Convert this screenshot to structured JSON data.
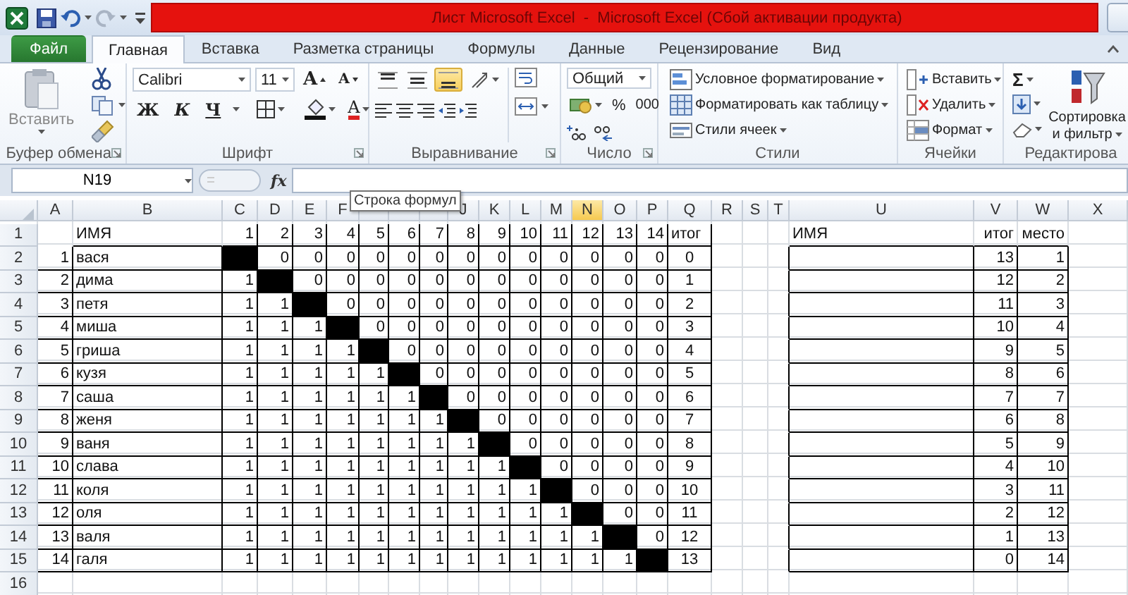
{
  "title_bar": {
    "title": "Лист Microsoft Excel  -  Microsoft Excel (Сбой активации продукта)"
  },
  "tabs": [
    {
      "label": "Файл",
      "kind": "file",
      "selected": false
    },
    {
      "label": "Главная",
      "kind": "tab",
      "selected": true
    },
    {
      "label": "Вставка",
      "kind": "tab",
      "selected": false
    },
    {
      "label": "Разметка страницы",
      "kind": "tab",
      "selected": false
    },
    {
      "label": "Формулы",
      "kind": "tab",
      "selected": false
    },
    {
      "label": "Данные",
      "kind": "tab",
      "selected": false
    },
    {
      "label": "Рецензирование",
      "kind": "tab",
      "selected": false
    },
    {
      "label": "Вид",
      "kind": "tab",
      "selected": false
    }
  ],
  "ribbon": {
    "groups": [
      {
        "kind": "clipboard",
        "label": "Буфер обмена",
        "paste_label": "Вставить"
      },
      {
        "kind": "font",
        "label": "Шрифт",
        "font_name": "Calibri",
        "font_size": "11",
        "grow": "A",
        "shrink": "A",
        "bold": "Ж",
        "italic": "К",
        "underline": "Ч",
        "font_color": "A"
      },
      {
        "kind": "alignment",
        "label": "Выравнивание",
        "vertical_buttons": [
          {
            "selected": false
          },
          {
            "selected": false
          },
          {
            "selected": true
          }
        ]
      },
      {
        "kind": "number",
        "label": "Число",
        "format": "Общий",
        "percent": "%",
        "thousands": "000"
      },
      {
        "kind": "styles",
        "label": "Стили",
        "buttons": [
          "Условное форматирование",
          "Форматировать как таблицу",
          "Стили ячеек"
        ]
      },
      {
        "kind": "cells",
        "label": "Ячейки",
        "buttons": [
          "Вставить",
          "Удалить",
          "Формат"
        ]
      },
      {
        "kind": "editing",
        "label": "Редактирова",
        "sigma": "Σ",
        "sort_label": "Сортировка и фильтр"
      }
    ]
  },
  "formula_bar": {
    "name_box": "N19",
    "function_label": "fx",
    "tooltip": "Строка формул"
  },
  "sheet": {
    "column_headers": [
      {
        "label": "A",
        "selected": false
      },
      {
        "label": "B",
        "selected": false
      },
      {
        "label": "C",
        "selected": false
      },
      {
        "label": "D",
        "selected": false
      },
      {
        "label": "E",
        "selected": false
      },
      {
        "label": "F",
        "selected": false
      },
      {
        "selected": false
      },
      {
        "selected": false
      },
      {
        "selected": false
      },
      {
        "label": "J",
        "selected": false
      },
      {
        "label": "K",
        "selected": false
      },
      {
        "label": "L",
        "selected": false
      },
      {
        "label": "M",
        "selected": false
      },
      {
        "label": "N",
        "selected": true
      },
      {
        "label": "O",
        "selected": false
      },
      {
        "label": "P",
        "selected": false
      },
      {
        "label": "Q",
        "selected": false
      },
      {
        "label": "R",
        "selected": false
      },
      {
        "label": "S",
        "selected": false
      },
      {
        "label": "T",
        "selected": false
      },
      {
        "label": "U",
        "selected": false
      },
      {
        "label": "V",
        "selected": false
      },
      {
        "label": "W",
        "selected": false
      },
      {
        "label": "X",
        "selected": false
      }
    ],
    "header_row": {
      "number": "1",
      "name": "ИМЯ",
      "scores": [
        "1",
        "2",
        "3",
        "4",
        "5",
        "6",
        "7",
        "8",
        "9",
        "10",
        "11",
        "12",
        "13",
        "14"
      ],
      "total": "итог",
      "rank_name": "ИМЯ",
      "rank_total": "итог",
      "rank_place": "место"
    },
    "rows": [
      {
        "number": "2",
        "index": "1",
        "name": "вася",
        "scores": [
          {
            "blocked": true
          },
          {
            "value": "0",
            "blocked": false
          },
          {
            "value": "0",
            "blocked": false
          },
          {
            "value": "0",
            "blocked": false
          },
          {
            "value": "0",
            "blocked": false
          },
          {
            "value": "0",
            "blocked": false
          },
          {
            "value": "0",
            "blocked": false
          },
          {
            "value": "0",
            "blocked": false
          },
          {
            "value": "0",
            "blocked": false
          },
          {
            "value": "0",
            "blocked": false
          },
          {
            "value": "0",
            "blocked": false
          },
          {
            "value": "0",
            "blocked": false
          },
          {
            "value": "0",
            "blocked": false
          },
          {
            "value": "0",
            "blocked": false
          }
        ],
        "total": "0",
        "rank_total": "13",
        "rank_place": "1"
      },
      {
        "number": "3",
        "index": "2",
        "name": "дима",
        "scores": [
          {
            "value": "1",
            "blocked": false
          },
          {
            "blocked": true
          },
          {
            "value": "0",
            "blocked": false
          },
          {
            "value": "0",
            "blocked": false
          },
          {
            "value": "0",
            "blocked": false
          },
          {
            "value": "0",
            "blocked": false
          },
          {
            "value": "0",
            "blocked": false
          },
          {
            "value": "0",
            "blocked": false
          },
          {
            "value": "0",
            "blocked": false
          },
          {
            "value": "0",
            "blocked": false
          },
          {
            "value": "0",
            "blocked": false
          },
          {
            "value": "0",
            "blocked": false
          },
          {
            "value": "0",
            "blocked": false
          },
          {
            "value": "0",
            "blocked": false
          }
        ],
        "total": "1",
        "rank_total": "12",
        "rank_place": "2"
      },
      {
        "number": "4",
        "index": "3",
        "name": "петя",
        "scores": [
          {
            "value": "1",
            "blocked": false
          },
          {
            "value": "1",
            "blocked": false
          },
          {
            "blocked": true
          },
          {
            "value": "0",
            "blocked": false
          },
          {
            "value": "0",
            "blocked": false
          },
          {
            "value": "0",
            "blocked": false
          },
          {
            "value": "0",
            "blocked": false
          },
          {
            "value": "0",
            "blocked": false
          },
          {
            "value": "0",
            "blocked": false
          },
          {
            "value": "0",
            "blocked": false
          },
          {
            "value": "0",
            "blocked": false
          },
          {
            "value": "0",
            "blocked": false
          },
          {
            "value": "0",
            "blocked": false
          },
          {
            "value": "0",
            "blocked": false
          }
        ],
        "total": "2",
        "rank_total": "11",
        "rank_place": "3"
      },
      {
        "number": "5",
        "index": "4",
        "name": "миша",
        "scores": [
          {
            "value": "1",
            "blocked": false
          },
          {
            "value": "1",
            "blocked": false
          },
          {
            "value": "1",
            "blocked": false
          },
          {
            "blocked": true
          },
          {
            "value": "0",
            "blocked": false
          },
          {
            "value": "0",
            "blocked": false
          },
          {
            "value": "0",
            "blocked": false
          },
          {
            "value": "0",
            "blocked": false
          },
          {
            "value": "0",
            "blocked": false
          },
          {
            "value": "0",
            "blocked": false
          },
          {
            "value": "0",
            "blocked": false
          },
          {
            "value": "0",
            "blocked": false
          },
          {
            "value": "0",
            "blocked": false
          },
          {
            "value": "0",
            "blocked": false
          }
        ],
        "total": "3",
        "rank_total": "10",
        "rank_place": "4"
      },
      {
        "number": "6",
        "index": "5",
        "name": "гриша",
        "scores": [
          {
            "value": "1",
            "blocked": false
          },
          {
            "value": "1",
            "blocked": false
          },
          {
            "value": "1",
            "blocked": false
          },
          {
            "value": "1",
            "blocked": false
          },
          {
            "blocked": true
          },
          {
            "value": "0",
            "blocked": false
          },
          {
            "value": "0",
            "blocked": false
          },
          {
            "value": "0",
            "blocked": false
          },
          {
            "value": "0",
            "blocked": false
          },
          {
            "value": "0",
            "blocked": false
          },
          {
            "value": "0",
            "blocked": false
          },
          {
            "value": "0",
            "blocked": false
          },
          {
            "value": "0",
            "blocked": false
          },
          {
            "value": "0",
            "blocked": false
          }
        ],
        "total": "4",
        "rank_total": "9",
        "rank_place": "5"
      },
      {
        "number": "7",
        "index": "6",
        "name": "кузя",
        "scores": [
          {
            "value": "1",
            "blocked": false
          },
          {
            "value": "1",
            "blocked": false
          },
          {
            "value": "1",
            "blocked": false
          },
          {
            "value": "1",
            "blocked": false
          },
          {
            "value": "1",
            "blocked": false
          },
          {
            "blocked": true
          },
          {
            "value": "0",
            "blocked": false
          },
          {
            "value": "0",
            "blocked": false
          },
          {
            "value": "0",
            "blocked": false
          },
          {
            "value": "0",
            "blocked": false
          },
          {
            "value": "0",
            "blocked": false
          },
          {
            "value": "0",
            "blocked": false
          },
          {
            "value": "0",
            "blocked": false
          },
          {
            "value": "0",
            "blocked": false
          }
        ],
        "total": "5",
        "rank_total": "8",
        "rank_place": "6"
      },
      {
        "number": "8",
        "index": "7",
        "name": "саша",
        "scores": [
          {
            "value": "1",
            "blocked": false
          },
          {
            "value": "1",
            "blocked": false
          },
          {
            "value": "1",
            "blocked": false
          },
          {
            "value": "1",
            "blocked": false
          },
          {
            "value": "1",
            "blocked": false
          },
          {
            "value": "1",
            "blocked": false
          },
          {
            "blocked": true
          },
          {
            "value": "0",
            "blocked": false
          },
          {
            "value": "0",
            "blocked": false
          },
          {
            "value": "0",
            "blocked": false
          },
          {
            "value": "0",
            "blocked": false
          },
          {
            "value": "0",
            "blocked": false
          },
          {
            "value": "0",
            "blocked": false
          },
          {
            "value": "0",
            "blocked": false
          }
        ],
        "total": "6",
        "rank_total": "7",
        "rank_place": "7"
      },
      {
        "number": "9",
        "index": "8",
        "name": "женя",
        "scores": [
          {
            "value": "1",
            "blocked": false
          },
          {
            "value": "1",
            "blocked": false
          },
          {
            "value": "1",
            "blocked": false
          },
          {
            "value": "1",
            "blocked": false
          },
          {
            "value": "1",
            "blocked": false
          },
          {
            "value": "1",
            "blocked": false
          },
          {
            "value": "1",
            "blocked": false
          },
          {
            "blocked": true
          },
          {
            "value": "0",
            "blocked": false
          },
          {
            "value": "0",
            "blocked": false
          },
          {
            "value": "0",
            "blocked": false
          },
          {
            "value": "0",
            "blocked": false
          },
          {
            "value": "0",
            "blocked": false
          },
          {
            "value": "0",
            "blocked": false
          }
        ],
        "total": "7",
        "rank_total": "6",
        "rank_place": "8"
      },
      {
        "number": "10",
        "index": "9",
        "name": "ваня",
        "scores": [
          {
            "value": "1",
            "blocked": false
          },
          {
            "value": "1",
            "blocked": false
          },
          {
            "value": "1",
            "blocked": false
          },
          {
            "value": "1",
            "blocked": false
          },
          {
            "value": "1",
            "blocked": false
          },
          {
            "value": "1",
            "blocked": false
          },
          {
            "value": "1",
            "blocked": false
          },
          {
            "value": "1",
            "blocked": false
          },
          {
            "blocked": true
          },
          {
            "value": "0",
            "blocked": false
          },
          {
            "value": "0",
            "blocked": false
          },
          {
            "value": "0",
            "blocked": false
          },
          {
            "value": "0",
            "blocked": false
          },
          {
            "value": "0",
            "blocked": false
          }
        ],
        "total": "8",
        "rank_total": "5",
        "rank_place": "9"
      },
      {
        "number": "11",
        "index": "10",
        "name": "слава",
        "scores": [
          {
            "value": "1",
            "blocked": false
          },
          {
            "value": "1",
            "blocked": false
          },
          {
            "value": "1",
            "blocked": false
          },
          {
            "value": "1",
            "blocked": false
          },
          {
            "value": "1",
            "blocked": false
          },
          {
            "value": "1",
            "blocked": false
          },
          {
            "value": "1",
            "blocked": false
          },
          {
            "value": "1",
            "blocked": false
          },
          {
            "value": "1",
            "blocked": false
          },
          {
            "blocked": true
          },
          {
            "value": "0",
            "blocked": false
          },
          {
            "value": "0",
            "blocked": false
          },
          {
            "value": "0",
            "blocked": false
          },
          {
            "value": "0",
            "blocked": false
          }
        ],
        "total": "9",
        "rank_total": "4",
        "rank_place": "10"
      },
      {
        "number": "12",
        "index": "11",
        "name": "коля",
        "scores": [
          {
            "value": "1",
            "blocked": false
          },
          {
            "value": "1",
            "blocked": false
          },
          {
            "value": "1",
            "blocked": false
          },
          {
            "value": "1",
            "blocked": false
          },
          {
            "value": "1",
            "blocked": false
          },
          {
            "value": "1",
            "blocked": false
          },
          {
            "value": "1",
            "blocked": false
          },
          {
            "value": "1",
            "blocked": false
          },
          {
            "value": "1",
            "blocked": false
          },
          {
            "value": "1",
            "blocked": false
          },
          {
            "blocked": true
          },
          {
            "value": "0",
            "blocked": false
          },
          {
            "value": "0",
            "blocked": false
          },
          {
            "value": "0",
            "blocked": false
          }
        ],
        "total": "10",
        "rank_total": "3",
        "rank_place": "11"
      },
      {
        "number": "13",
        "index": "12",
        "name": "оля",
        "scores": [
          {
            "value": "1",
            "blocked": false
          },
          {
            "value": "1",
            "blocked": false
          },
          {
            "value": "1",
            "blocked": false
          },
          {
            "value": "1",
            "blocked": false
          },
          {
            "value": "1",
            "blocked": false
          },
          {
            "value": "1",
            "blocked": false
          },
          {
            "value": "1",
            "blocked": false
          },
          {
            "value": "1",
            "blocked": false
          },
          {
            "value": "1",
            "blocked": false
          },
          {
            "value": "1",
            "blocked": false
          },
          {
            "value": "1",
            "blocked": false
          },
          {
            "blocked": true
          },
          {
            "value": "0",
            "blocked": false
          },
          {
            "value": "0",
            "blocked": false
          }
        ],
        "total": "11",
        "rank_total": "2",
        "rank_place": "12"
      },
      {
        "number": "14",
        "index": "13",
        "name": "валя",
        "scores": [
          {
            "value": "1",
            "blocked": false
          },
          {
            "value": "1",
            "blocked": false
          },
          {
            "value": "1",
            "blocked": false
          },
          {
            "value": "1",
            "blocked": false
          },
          {
            "value": "1",
            "blocked": false
          },
          {
            "value": "1",
            "blocked": false
          },
          {
            "value": "1",
            "blocked": false
          },
          {
            "value": "1",
            "blocked": false
          },
          {
            "value": "1",
            "blocked": false
          },
          {
            "value": "1",
            "blocked": false
          },
          {
            "value": "1",
            "blocked": false
          },
          {
            "value": "1",
            "blocked": false
          },
          {
            "blocked": true
          },
          {
            "value": "0",
            "blocked": false
          }
        ],
        "total": "12",
        "rank_total": "1",
        "rank_place": "13"
      },
      {
        "number": "15",
        "index": "14",
        "name": "галя",
        "scores": [
          {
            "value": "1",
            "blocked": false
          },
          {
            "value": "1",
            "blocked": false
          },
          {
            "value": "1",
            "blocked": false
          },
          {
            "value": "1",
            "blocked": false
          },
          {
            "value": "1",
            "blocked": false
          },
          {
            "value": "1",
            "blocked": false
          },
          {
            "value": "1",
            "blocked": false
          },
          {
            "value": "1",
            "blocked": false
          },
          {
            "value": "1",
            "blocked": false
          },
          {
            "value": "1",
            "blocked": false
          },
          {
            "value": "1",
            "blocked": false
          },
          {
            "value": "1",
            "blocked": false
          },
          {
            "value": "1",
            "blocked": false
          },
          {
            "blocked": true
          }
        ],
        "total": "13",
        "rank_total": "0",
        "rank_place": "14"
      }
    ],
    "empty_rows": [
      "16"
    ]
  }
}
